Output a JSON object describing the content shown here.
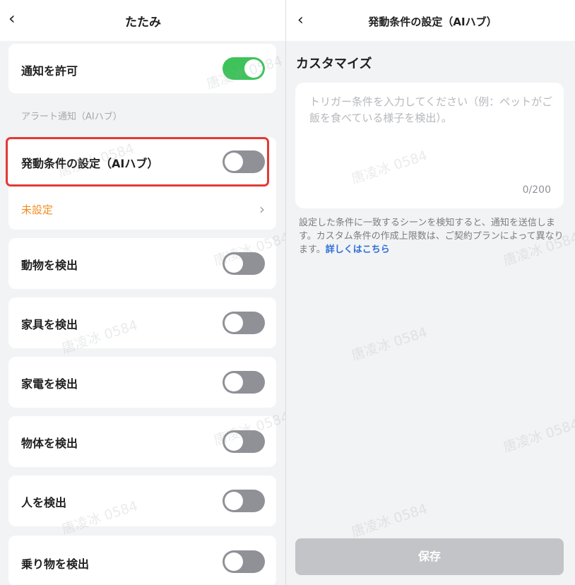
{
  "left": {
    "back_icon": "‹",
    "title": "たたみ",
    "notification": {
      "label": "通知を許可",
      "enabled": true
    },
    "section_title": "アラート通知（AIハブ）",
    "trigger": {
      "label": "発動条件の設定（AIハブ）",
      "enabled": false,
      "status": "未設定",
      "chevron": "›"
    },
    "detections": [
      {
        "label": "動物を検出",
        "enabled": false
      },
      {
        "label": "家具を検出",
        "enabled": false
      },
      {
        "label": "家電を検出",
        "enabled": false
      },
      {
        "label": "物体を検出",
        "enabled": false
      },
      {
        "label": "人を検出",
        "enabled": false
      },
      {
        "label": "乗り物を検出",
        "enabled": false
      }
    ]
  },
  "right": {
    "back_icon": "‹",
    "title": "発動条件の設定（AIハブ）",
    "custom_title": "カスタマイズ",
    "input": {
      "placeholder": "トリガー条件を入力してください（例：ペットがご飯を食べている様子を検出）。",
      "counter": "0/200"
    },
    "description": "設定した条件に一致するシーンを検知すると、通知を送信します。カスタム条件の作成上限数は、ご契約プランによって異なります。",
    "link": "詳しくはこちら",
    "save_label": "保存"
  },
  "watermark_text": "唐凌冰 0584",
  "colors": {
    "toggle_on": "#3ec35b",
    "toggle_off": "#8f9196",
    "highlight": "#e53935",
    "status": "#f08c1d",
    "link": "#2f6fd6",
    "button_disabled": "#c3c4c7"
  }
}
